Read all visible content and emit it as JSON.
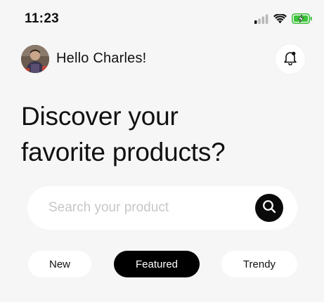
{
  "status_bar": {
    "time": "11:23",
    "icons": [
      "cellular-signal-icon",
      "wifi-icon",
      "battery-charging-icon"
    ],
    "battery_color": "#3cc43a"
  },
  "header": {
    "greeting": "Hello Charles!",
    "avatar_alt": "user-avatar",
    "notification_icon": "bell-icon",
    "notification_dot": true
  },
  "headline": {
    "line1": "Discover your",
    "line2": "favorite products?"
  },
  "search": {
    "placeholder": "Search your product",
    "value": "",
    "button_icon": "search-icon"
  },
  "tabs": [
    {
      "label": "New",
      "active": false
    },
    {
      "label": "Featured",
      "active": true
    },
    {
      "label": "Trendy",
      "active": false
    }
  ],
  "colors": {
    "background": "#f6f6f6",
    "surface": "#ffffff",
    "accent": "#000000",
    "placeholder": "#c7c7c7"
  }
}
